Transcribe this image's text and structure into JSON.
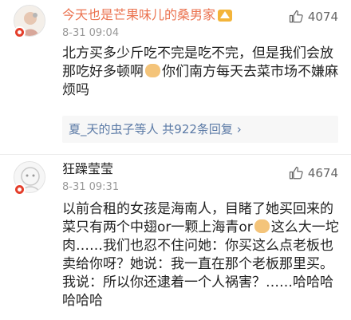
{
  "comments": [
    {
      "username": "今天也是芒果味儿的桑男家",
      "time": "8-31 09:04",
      "likes": "4074",
      "text": "北方买多少斤吃不完是吃不完，但是我们会放那吃好多顿啊",
      "text2": "你们南方每天去菜市场不嫌麻烦吗",
      "reply_summary": {
        "names": "夏_天的虫子等人",
        "count_text": "共922条回复",
        "arrow": "›"
      }
    },
    {
      "username": "狂躁莹莹",
      "time": "8-31 09:31",
      "likes": "4674",
      "text": "以前合租的女孩是海南人，目睹了她买回来的菜只有两个中翅or一颗上海青or",
      "text2": "这么大一坨肉……我们也忍不住问她：你买这么点老板也卖给你呀？她说：我一直在那个老板那里买。我说：所以你还逮着一个人祸害？……哈哈哈哈哈哈"
    }
  ],
  "colors": {
    "vip_name": "#eb7350",
    "link": "#5b7aa6",
    "meta": "#999999"
  },
  "icons": [
    "avatar",
    "verified-badge",
    "crown-badge",
    "thumbs-up-icon",
    "emoji"
  ]
}
